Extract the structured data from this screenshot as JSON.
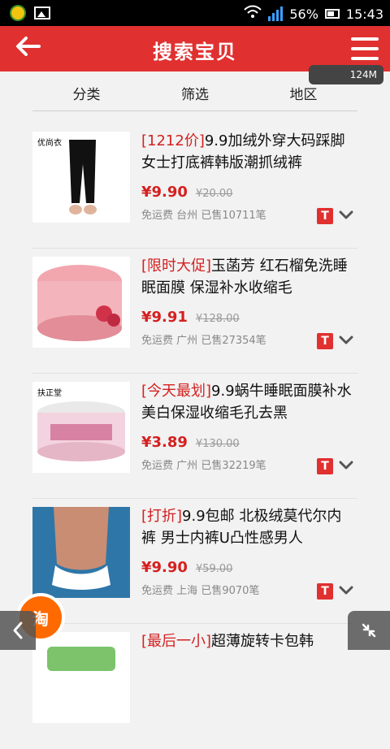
{
  "status_bar": {
    "battery": "56%",
    "time": "15:43"
  },
  "header": {
    "title": "搜索宝贝"
  },
  "network_overlay": {
    "speed": "124M"
  },
  "tabs": [
    {
      "label": "分类"
    },
    {
      "label": "筛选"
    },
    {
      "label": "地区"
    }
  ],
  "products": [
    {
      "prefix": "[1212价]",
      "title": "9.9加绒外穿大码踩脚女士打底裤韩版潮抓绒裤",
      "price": "¥9.90",
      "original_price": "¥20.00",
      "shipping": "免运费",
      "location": "台州",
      "sold": "已售10711笔",
      "thumb_tag": "优尚衣"
    },
    {
      "prefix": "[限时大促]",
      "title": "玉菡芳 红石榴免洗睡眠面膜 保湿补水收缩毛",
      "price": "¥9.91",
      "original_price": "¥128.00",
      "shipping": "免运费",
      "location": "广州",
      "sold": "已售27354笔",
      "thumb_tag": ""
    },
    {
      "prefix": "[今天最划]",
      "title": "9.9蜗牛睡眠面膜补水美白保湿收缩毛孔去黑",
      "price": "¥3.89",
      "original_price": "¥130.00",
      "shipping": "免运费",
      "location": "广州",
      "sold": "已售32219笔",
      "thumb_tag": "扶正堂"
    },
    {
      "prefix": "[打折]",
      "title": "9.9包邮 北极绒莫代尔内裤 男士内裤U凸性感男人",
      "price": "¥9.90",
      "original_price": "¥59.00",
      "shipping": "免运费",
      "location": "上海",
      "sold": "已售9070笔",
      "thumb_tag": ""
    },
    {
      "prefix": "[最后一小]",
      "title": "超薄旋转卡包韩",
      "price": "",
      "original_price": "",
      "shipping": "",
      "location": "",
      "sold": "",
      "thumb_tag": ""
    }
  ],
  "floating": {
    "taobao_label": "淘"
  },
  "colors": {
    "accent": "#e03030",
    "price": "#d52020",
    "taobao": "#ff6a00"
  }
}
